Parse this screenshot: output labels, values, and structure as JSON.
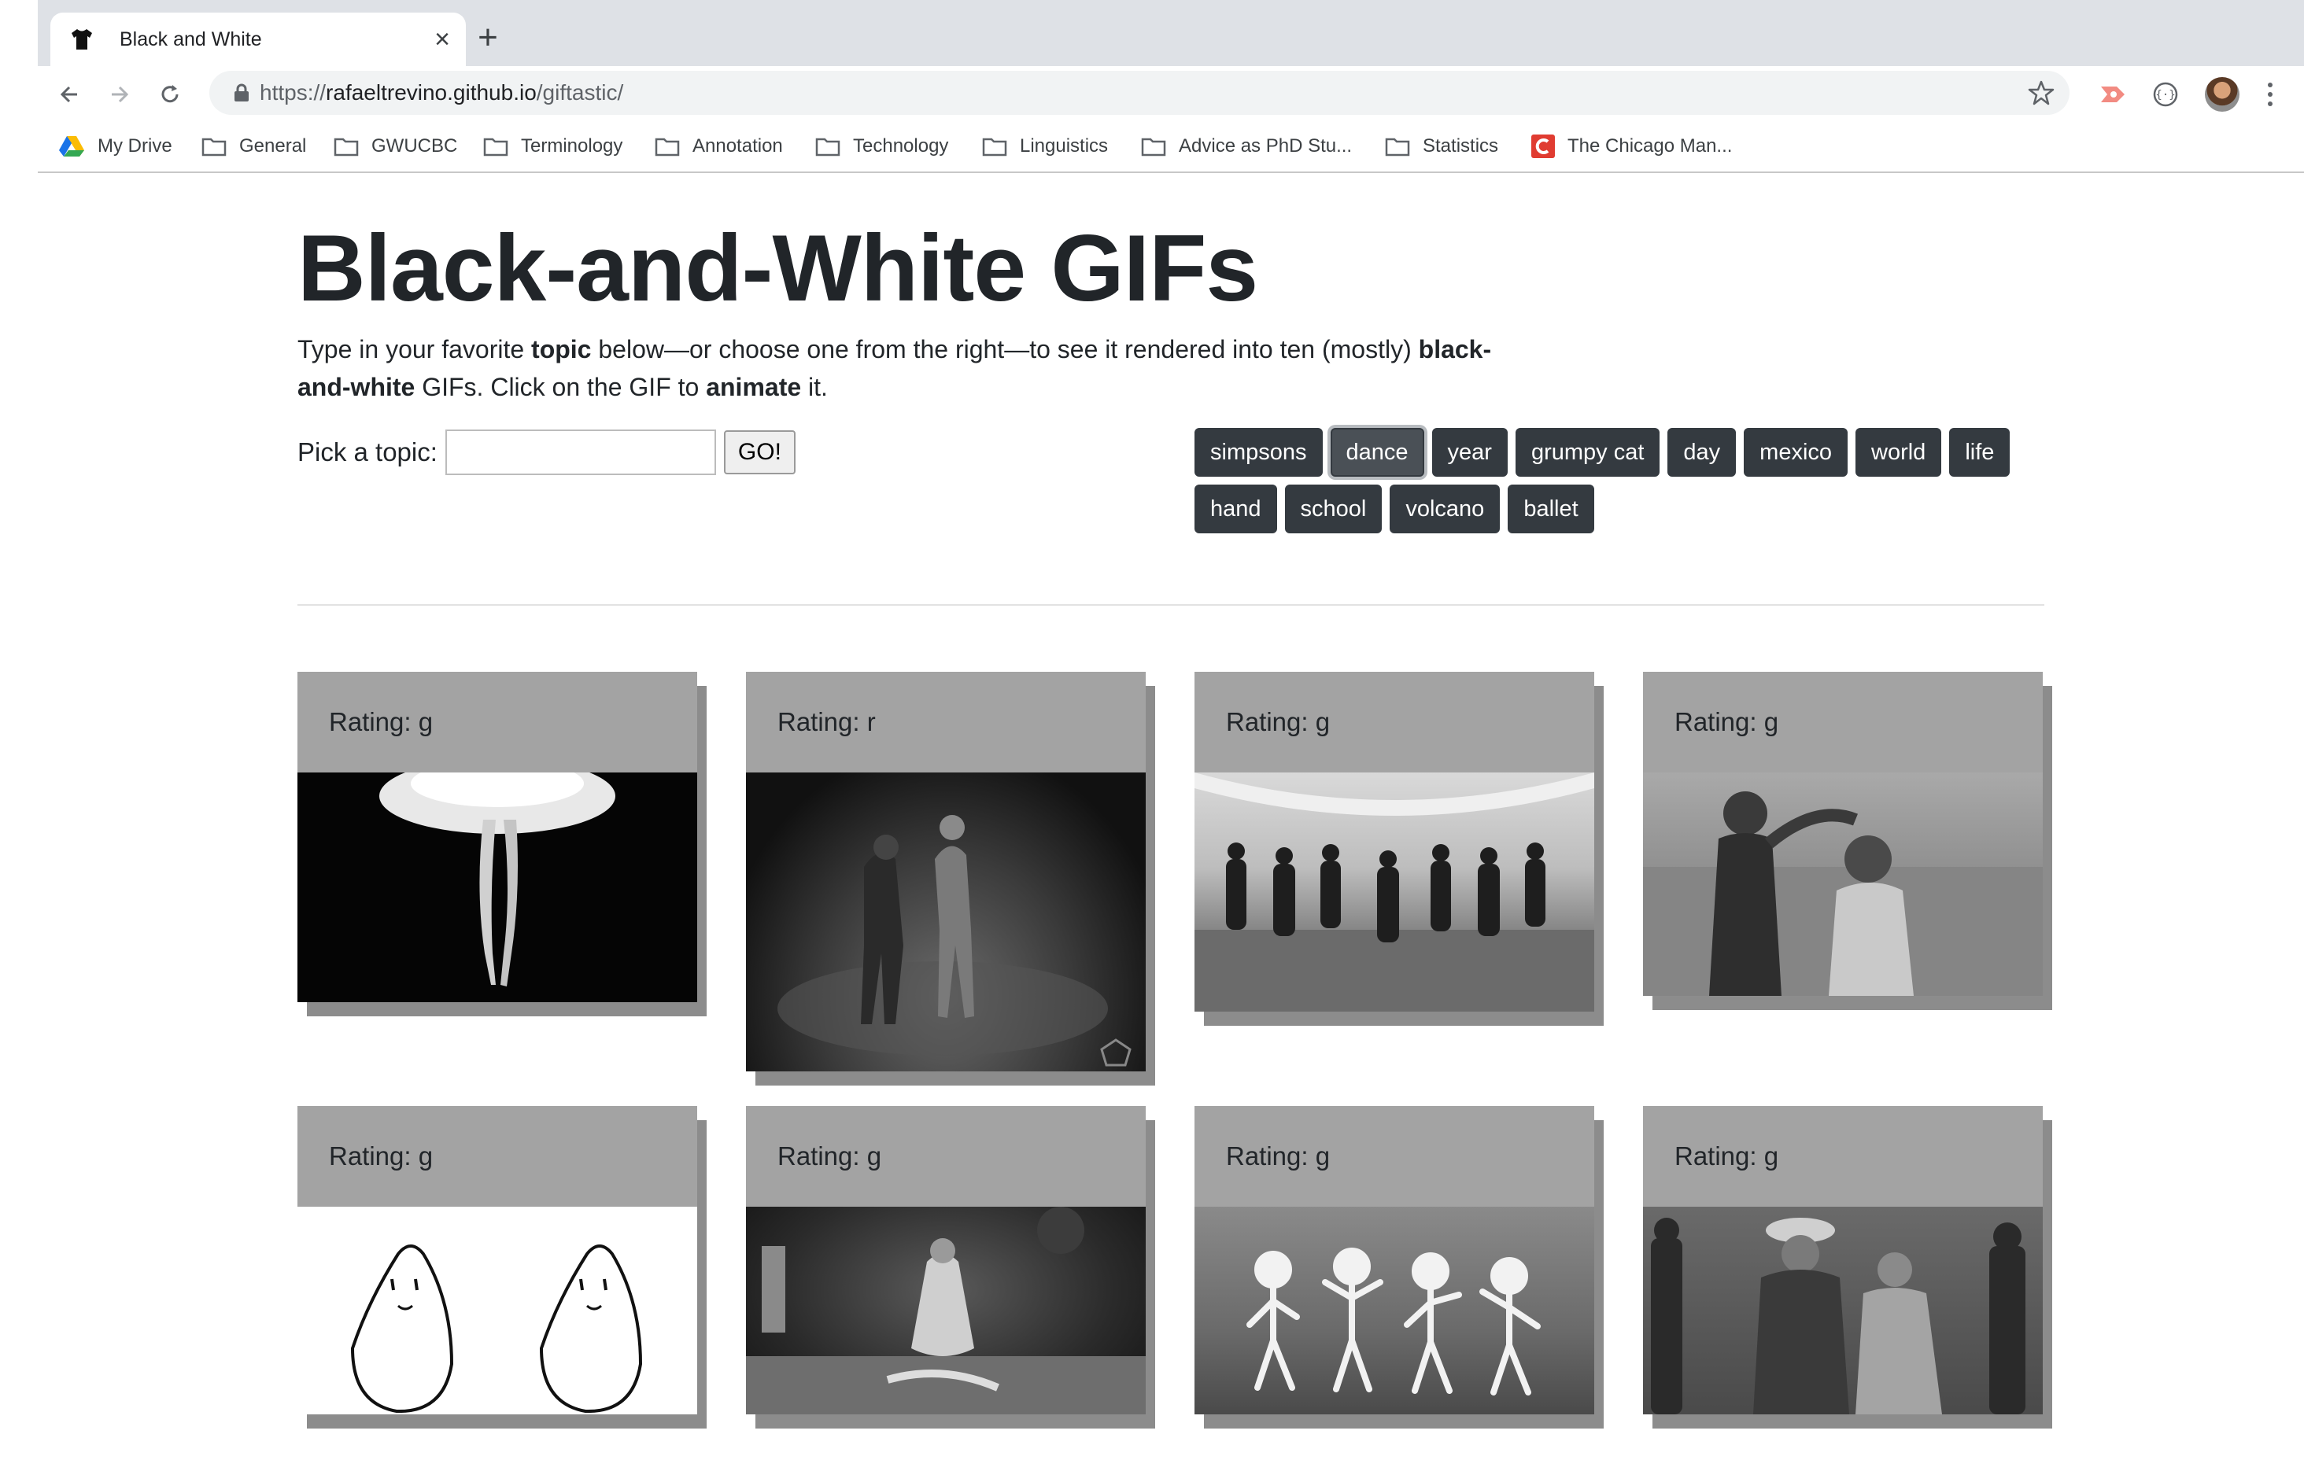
{
  "browser": {
    "tab_title": "Black and White",
    "url_scheme": "https://",
    "url_host": "rafaeltrevino.github.io",
    "url_path": "/giftastic/",
    "bookmarks": [
      "My Drive",
      "General",
      "GWUCBC",
      "Terminology",
      "Annotation",
      "Technology",
      "Linguistics",
      "Advice as PhD Stu...",
      "Statistics",
      "The Chicago Man..."
    ]
  },
  "page": {
    "title": "Black-and-White GIFs",
    "intro_1": "Type in your favorite ",
    "intro_topic": "topic",
    "intro_2": " below—or choose one from the right—to see it rendered into ten (mostly) ",
    "intro_bw": "black-and-white",
    "intro_3": " GIFs. Click on the GIF to ",
    "intro_animate": "animate",
    "intro_4": " it.",
    "pick_label": "Pick a topic:",
    "input_value": "",
    "go_label": "GO!",
    "topics": [
      "simpsons",
      "dance",
      "year",
      "grumpy cat",
      "day",
      "mexico",
      "world",
      "life",
      "hand",
      "school",
      "volcano",
      "ballet"
    ],
    "active_topic": "dance"
  },
  "cards": [
    {
      "rating": "Rating: g",
      "image": "ballet-dancer-legs"
    },
    {
      "rating": "Rating: r",
      "image": "couple-dancing-spotlight"
    },
    {
      "rating": "Rating: g",
      "image": "flapper-dance-hall"
    },
    {
      "rating": "Rating: g",
      "image": "couple-beach-dance"
    },
    {
      "rating": "Rating: g",
      "image": "cartoon-potatoes-dancing"
    },
    {
      "rating": "Rating: g",
      "image": "vintage-stage-dancer"
    },
    {
      "rating": "Rating: g",
      "image": "dancing-skeletons"
    },
    {
      "rating": "Rating: g",
      "image": "old-film-crowd-dance"
    }
  ]
}
